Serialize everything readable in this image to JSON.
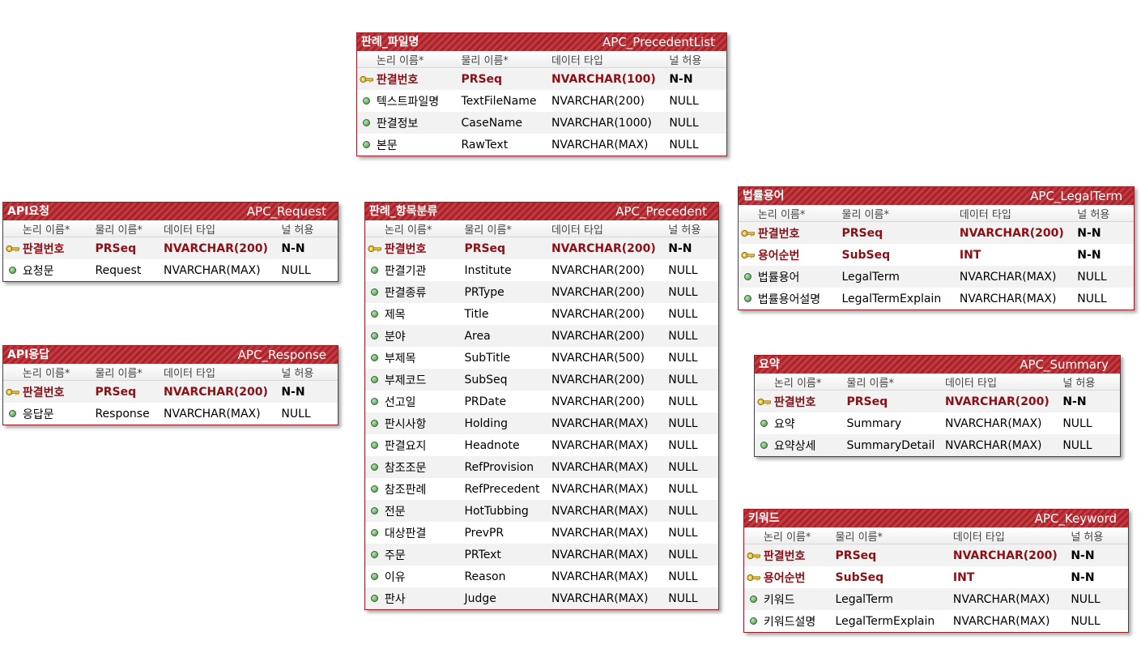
{
  "header_labels": {
    "logical": "논리 이름*",
    "physical": "물리 이름*",
    "type": "데이터 타입",
    "nullable": "널 허용"
  },
  "entities": [
    {
      "id": "precedentlist",
      "logical_name": "판례_파일명",
      "physical_name": "APC_PrecedentList",
      "columns": [
        {
          "logical": "판결번호",
          "physical": "PRSeq",
          "type": "NVARCHAR(100)",
          "nullable": "N-N",
          "pk": true
        },
        {
          "logical": "텍스트파일명",
          "physical": "TextFileName",
          "type": "NVARCHAR(200)",
          "nullable": "NULL",
          "pk": false
        },
        {
          "logical": "판결정보",
          "physical": "CaseName",
          "type": "NVARCHAR(1000)",
          "nullable": "NULL",
          "pk": false
        },
        {
          "logical": "본문",
          "physical": "RawText",
          "type": "NVARCHAR(MAX)",
          "nullable": "NULL",
          "pk": false
        }
      ]
    },
    {
      "id": "request",
      "logical_name": "API요청",
      "physical_name": "APC_Request",
      "columns": [
        {
          "logical": "판결번호",
          "physical": "PRSeq",
          "type": "NVARCHAR(200)",
          "nullable": "N-N",
          "pk": true
        },
        {
          "logical": "요청문",
          "physical": "Request",
          "type": "NVARCHAR(MAX)",
          "nullable": "NULL",
          "pk": false
        }
      ]
    },
    {
      "id": "response",
      "logical_name": "API응답",
      "physical_name": "APC_Response",
      "columns": [
        {
          "logical": "판결번호",
          "physical": "PRSeq",
          "type": "NVARCHAR(200)",
          "nullable": "N-N",
          "pk": true
        },
        {
          "logical": "응답문",
          "physical": "Response",
          "type": "NVARCHAR(MAX)",
          "nullable": "NULL",
          "pk": false
        }
      ]
    },
    {
      "id": "precedent",
      "logical_name": "판례_항목분류",
      "physical_name": "APC_Precedent",
      "columns": [
        {
          "logical": "판결번호",
          "physical": "PRSeq",
          "type": "NVARCHAR(200)",
          "nullable": "N-N",
          "pk": true
        },
        {
          "logical": "판결기관",
          "physical": "Institute",
          "type": "NVARCHAR(200)",
          "nullable": "NULL",
          "pk": false
        },
        {
          "logical": "판결종류",
          "physical": "PRType",
          "type": "NVARCHAR(200)",
          "nullable": "NULL",
          "pk": false
        },
        {
          "logical": "제목",
          "physical": "Title",
          "type": "NVARCHAR(200)",
          "nullable": "NULL",
          "pk": false
        },
        {
          "logical": "분야",
          "physical": "Area",
          "type": "NVARCHAR(200)",
          "nullable": "NULL",
          "pk": false
        },
        {
          "logical": "부제목",
          "physical": "SubTitle",
          "type": "NVARCHAR(500)",
          "nullable": "NULL",
          "pk": false
        },
        {
          "logical": "부제코드",
          "physical": "SubSeq",
          "type": "NVARCHAR(200)",
          "nullable": "NULL",
          "pk": false
        },
        {
          "logical": "선고일",
          "physical": "PRDate",
          "type": "NVARCHAR(200)",
          "nullable": "NULL",
          "pk": false
        },
        {
          "logical": "판시사항",
          "physical": "Holding",
          "type": "NVARCHAR(MAX)",
          "nullable": "NULL",
          "pk": false
        },
        {
          "logical": "판결요지",
          "physical": "Headnote",
          "type": "NVARCHAR(MAX)",
          "nullable": "NULL",
          "pk": false
        },
        {
          "logical": "참조조문",
          "physical": "RefProvision",
          "type": "NVARCHAR(MAX)",
          "nullable": "NULL",
          "pk": false
        },
        {
          "logical": "참조판례",
          "physical": "RefPrecedent",
          "type": "NVARCHAR(MAX)",
          "nullable": "NULL",
          "pk": false
        },
        {
          "logical": "전문",
          "physical": "HotTubbing",
          "type": "NVARCHAR(MAX)",
          "nullable": "NULL",
          "pk": false
        },
        {
          "logical": "대상판결",
          "physical": "PrevPR",
          "type": "NVARCHAR(MAX)",
          "nullable": "NULL",
          "pk": false
        },
        {
          "logical": "주문",
          "physical": "PRText",
          "type": "NVARCHAR(MAX)",
          "nullable": "NULL",
          "pk": false
        },
        {
          "logical": "이유",
          "physical": "Reason",
          "type": "NVARCHAR(MAX)",
          "nullable": "NULL",
          "pk": false
        },
        {
          "logical": "판사",
          "physical": "Judge",
          "type": "NVARCHAR(MAX)",
          "nullable": "NULL",
          "pk": false
        }
      ]
    },
    {
      "id": "legalterm",
      "logical_name": "법률용어",
      "physical_name": "APC_LegalTerm",
      "columns": [
        {
          "logical": "판결번호",
          "physical": "PRSeq",
          "type": "NVARCHAR(200)",
          "nullable": "N-N",
          "pk": true
        },
        {
          "logical": "용어순번",
          "physical": "SubSeq",
          "type": "INT",
          "nullable": "N-N",
          "pk": true
        },
        {
          "logical": "법률용어",
          "physical": "LegalTerm",
          "type": "NVARCHAR(MAX)",
          "nullable": "NULL",
          "pk": false
        },
        {
          "logical": "법률용어설명",
          "physical": "LegalTermExplain",
          "type": "NVARCHAR(MAX)",
          "nullable": "NULL",
          "pk": false
        }
      ]
    },
    {
      "id": "summary",
      "logical_name": "요약",
      "physical_name": "APC_Summary",
      "columns": [
        {
          "logical": "판결번호",
          "physical": "PRSeq",
          "type": "NVARCHAR(200)",
          "nullable": "N-N",
          "pk": true
        },
        {
          "logical": "요약",
          "physical": "Summary",
          "type": "NVARCHAR(MAX)",
          "nullable": "NULL",
          "pk": false
        },
        {
          "logical": "요약상세",
          "physical": "SummaryDetail",
          "type": "NVARCHAR(MAX)",
          "nullable": "NULL",
          "pk": false
        }
      ]
    },
    {
      "id": "keyword",
      "logical_name": "키워드",
      "physical_name": "APC_Keyword",
      "columns": [
        {
          "logical": "판결번호",
          "physical": "PRSeq",
          "type": "NVARCHAR(200)",
          "nullable": "N-N",
          "pk": true
        },
        {
          "logical": "용어순번",
          "physical": "SubSeq",
          "type": "INT",
          "nullable": "N-N",
          "pk": true
        },
        {
          "logical": "키워드",
          "physical": "LegalTerm",
          "type": "NVARCHAR(MAX)",
          "nullable": "NULL",
          "pk": false
        },
        {
          "logical": "키워드설명",
          "physical": "LegalTermExplain",
          "type": "NVARCHAR(MAX)",
          "nullable": "NULL",
          "pk": false
        }
      ]
    }
  ],
  "colors": {
    "header": "#a8232b",
    "pk_text": "#8b1016",
    "key_icon": "#e0b020",
    "col_icon": "#3e8a3e"
  }
}
